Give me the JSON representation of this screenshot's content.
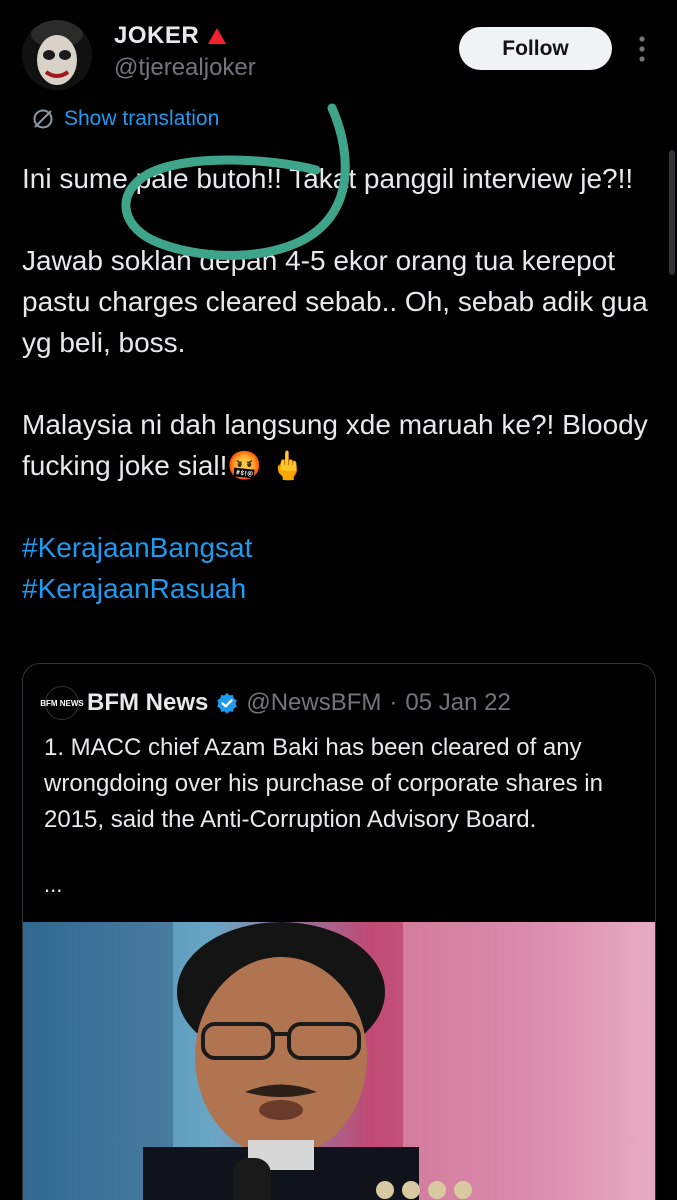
{
  "author": {
    "display_name": "JOKER",
    "badge_color": "#f4212e",
    "handle": "@tjerealjoker"
  },
  "follow_label": "Follow",
  "more_icon": "more-vertical-icon",
  "translate_label": "Show translation",
  "tweet": {
    "para1": "Ini sume pale butoh!! Takat panggil interview je?!!",
    "para2": "Jawab soklan depan 4-5 ekor orang tua kerepot pastu charges cleared sebab.. Oh, sebab adik gua yg beli, boss.",
    "para3": "Malaysia ni dah langsung xde maruah ke?! Bloody fucking joke sial!🤬 🖕",
    "hashtags": [
      "#KerajaanBangsat",
      "#KerajaanRasuah"
    ]
  },
  "annotation_color": "#3fa58a",
  "quote": {
    "logo_text": "BFM NEWS",
    "name": "BFM News",
    "handle": "@NewsBFM",
    "separator": "·",
    "date": "05 Jan 22",
    "text": "1. MACC chief Azam Baki has been cleared of any wrongdoing over his purchase of corporate shares in 2015, said the Anti-Corruption Advisory Board.",
    "ellipsis": "..."
  },
  "colors": {
    "link": "#1d9bf0",
    "verified": "#1d9bf0",
    "muted": "#71767b",
    "text": "#e7e9ea"
  }
}
